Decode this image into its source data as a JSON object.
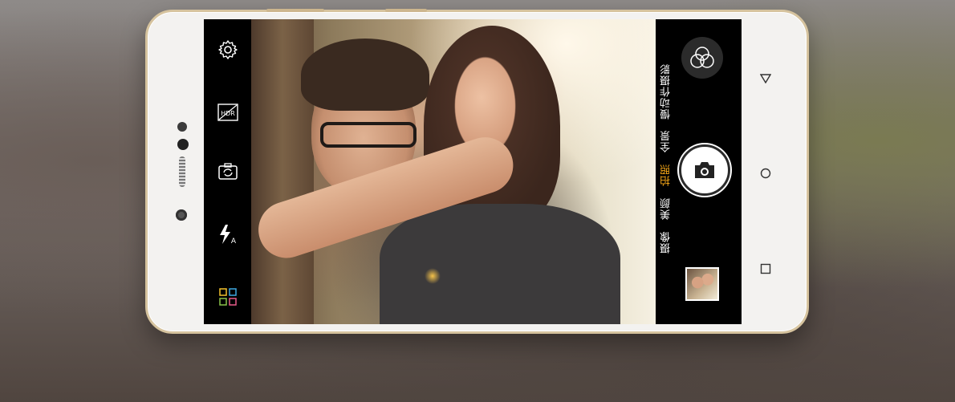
{
  "camera_app": {
    "left_tools": [
      {
        "icon": "settings-gear-icon"
      },
      {
        "icon": "hdr-off-icon",
        "label": "HDR"
      },
      {
        "icon": "switch-camera-icon"
      },
      {
        "icon": "flash-auto-icon",
        "label": "A"
      },
      {
        "icon": "apps-grid-icon"
      }
    ],
    "modes": [
      {
        "label": "慢动作摄影",
        "active": false
      },
      {
        "label": "全景",
        "active": false
      },
      {
        "label": "拍照",
        "active": true
      },
      {
        "label": "美颜",
        "active": false
      },
      {
        "label": "摄像",
        "active": false
      }
    ],
    "filters_icon": "filters-circles-icon",
    "shutter_icon": "camera-icon",
    "gallery_thumbnail": "gallery-thumbnail"
  },
  "phone_nav": {
    "buttons": [
      "back-triangle-icon",
      "home-circle-icon",
      "recents-square-icon"
    ]
  },
  "colors": {
    "active_mode": "#f2a417",
    "phone_frame": "#f3f2f0",
    "phone_trim": "#d6c39e",
    "screen_bg": "#000000"
  }
}
